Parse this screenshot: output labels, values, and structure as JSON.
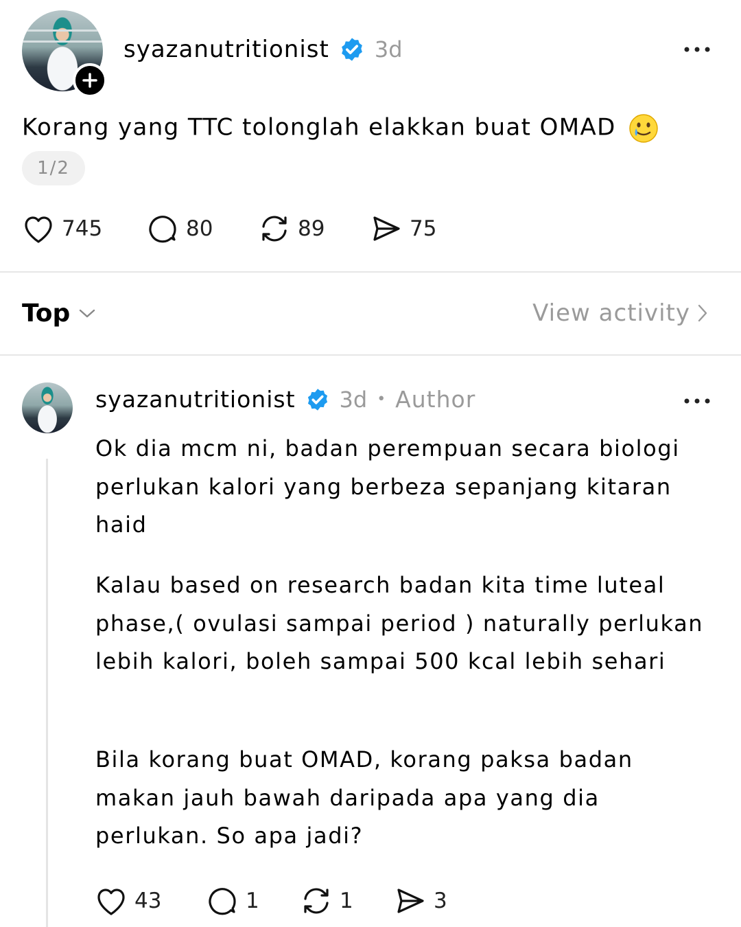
{
  "post": {
    "username": "syazanutritionist",
    "time": "3d",
    "text": "Korang yang TTC tolonglah elakkan buat OMAD",
    "page_indicator": "1/2",
    "stats": {
      "likes": "745",
      "comments": "80",
      "reposts": "89",
      "shares": "75"
    }
  },
  "sort": {
    "label": "Top",
    "view_activity": "View activity"
  },
  "reply": {
    "username": "syazanutritionist",
    "time": "3d",
    "separator": "•",
    "author_tag": "Author",
    "paragraphs": [
      "Ok dia mcm ni, badan perempuan secara biologi perlukan kalori yang berbeza sepanjang kitaran haid",
      "Kalau based on research badan kita time  luteal phase,( ovulasi sampai period )  naturally perlukan lebih kalori, boleh sampai 500 kcal lebih sehari",
      "Bila korang buat OMAD, korang paksa badan makan jauh bawah daripada apa yang dia perlukan. So apa jadi?"
    ],
    "stats": {
      "likes": "43",
      "comments": "1",
      "reposts": "1",
      "shares": "3"
    }
  },
  "colors": {
    "verified": "#1d9bf0",
    "muted": "#9a9a9a",
    "divider": "#e6e6e6"
  },
  "icons": [
    "plus-icon",
    "verified-badge-icon",
    "more-options-icon",
    "crying-smile-emoji-icon",
    "heart-icon",
    "comment-icon",
    "repost-icon",
    "share-icon",
    "chevron-down-icon",
    "chevron-right-icon"
  ]
}
